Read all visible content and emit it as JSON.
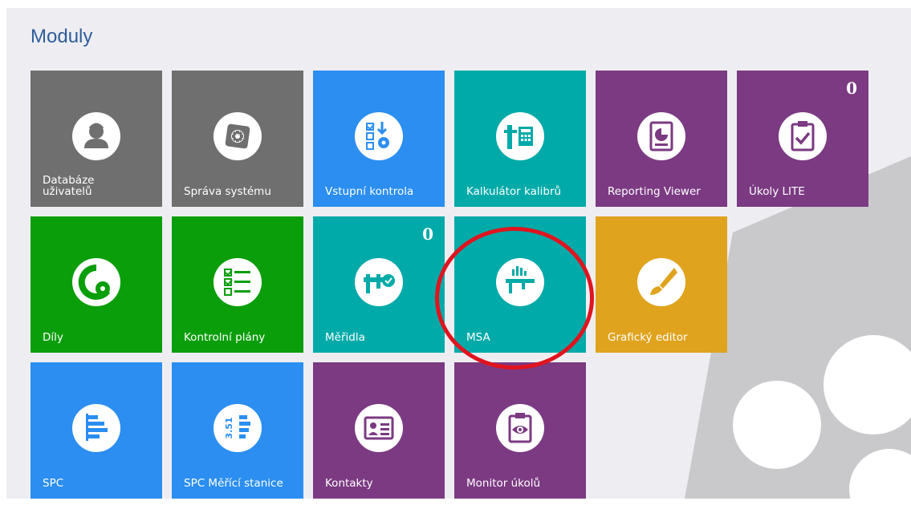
{
  "header": {
    "title": "Moduly"
  },
  "tiles": [
    {
      "label": "Databáze\nuživatelů",
      "color": "#6f6f6f",
      "icon": "user-icon"
    },
    {
      "label": "Správa systému",
      "color": "#6f6f6f",
      "icon": "gear-icon"
    },
    {
      "label": "Vstupní kontrola",
      "color": "#2b8ef0",
      "icon": "checklist-gear-icon"
    },
    {
      "label": "Kalkulátor kalibrů",
      "color": "#00aaa8",
      "icon": "caliper-calculator-icon"
    },
    {
      "label": "Reporting Viewer",
      "color": "#7b3a82",
      "icon": "report-chart-icon"
    },
    {
      "label": "Úkoly LITE",
      "color": "#7b3a82",
      "icon": "clipboard-check-icon",
      "badge": "0"
    },
    {
      "label": "Díly",
      "color": "#0a9e0a",
      "icon": "part-gear-icon"
    },
    {
      "label": "Kontrolní plány",
      "color": "#0a9e0a",
      "icon": "checklist-icon"
    },
    {
      "label": "Měřidla",
      "color": "#00aaa8",
      "icon": "caliper-check-icon",
      "badge": "0"
    },
    {
      "label": "MSA",
      "color": "#00aaa8",
      "icon": "caliper-histogram-icon"
    },
    {
      "label": "Grafický editor",
      "color": "#e0a31e",
      "icon": "paintbrush-icon"
    },
    {
      "label": "SPC",
      "color": "#2b8ef0",
      "icon": "bar-chart-icon"
    },
    {
      "label": "SPC Měřící stanice",
      "color": "#2b8ef0",
      "icon": "measure-station-icon",
      "icon_text": "3.51"
    },
    {
      "label": "Kontakty",
      "color": "#7b3a82",
      "icon": "contact-card-icon"
    },
    {
      "label": "Monitor úkolů",
      "color": "#7b3a82",
      "icon": "clipboard-eye-icon"
    }
  ],
  "highlight": {
    "target": "MSA",
    "color": "#e0141e"
  }
}
